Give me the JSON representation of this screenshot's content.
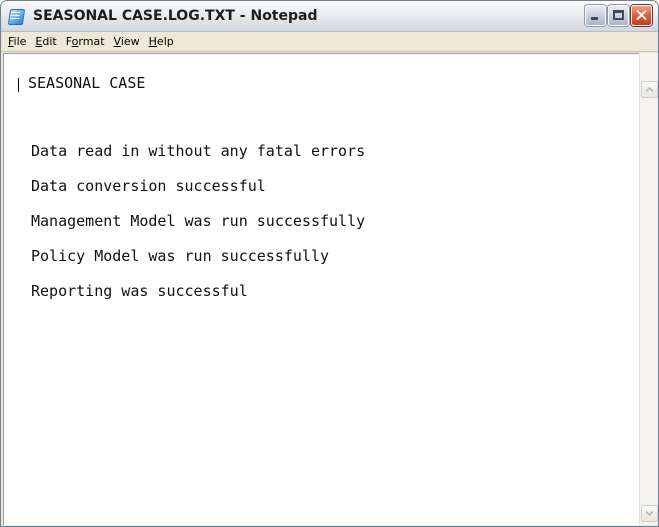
{
  "window": {
    "title": "SEASONAL CASE.LOG.TXT - Notepad"
  },
  "menu": {
    "file": {
      "acc": "F",
      "rest": "ile"
    },
    "edit": {
      "acc": "E",
      "rest": "dit"
    },
    "format": {
      "pre": "F",
      "acc": "o",
      "rest": "rmat"
    },
    "view": {
      "acc": "V",
      "rest": "iew"
    },
    "help": {
      "acc": "H",
      "rest": "elp"
    }
  },
  "document": {
    "lines": [
      "SEASONAL CASE",
      "Data read in without any fatal errors",
      "Data conversion successful",
      "Management Model was run successfully",
      "Policy Model was run successfully",
      "Reporting was successful"
    ]
  },
  "icons": {
    "app": "notepad-icon",
    "minimize": "minimize-icon",
    "maximize": "maximize-icon",
    "close": "close-icon",
    "scroll_up": "chevron-up-icon",
    "scroll_down": "chevron-down-icon"
  },
  "colors": {
    "close_button": "#e0603a",
    "menubar": "#ece9d8",
    "editor_bg": "#ffffff"
  }
}
